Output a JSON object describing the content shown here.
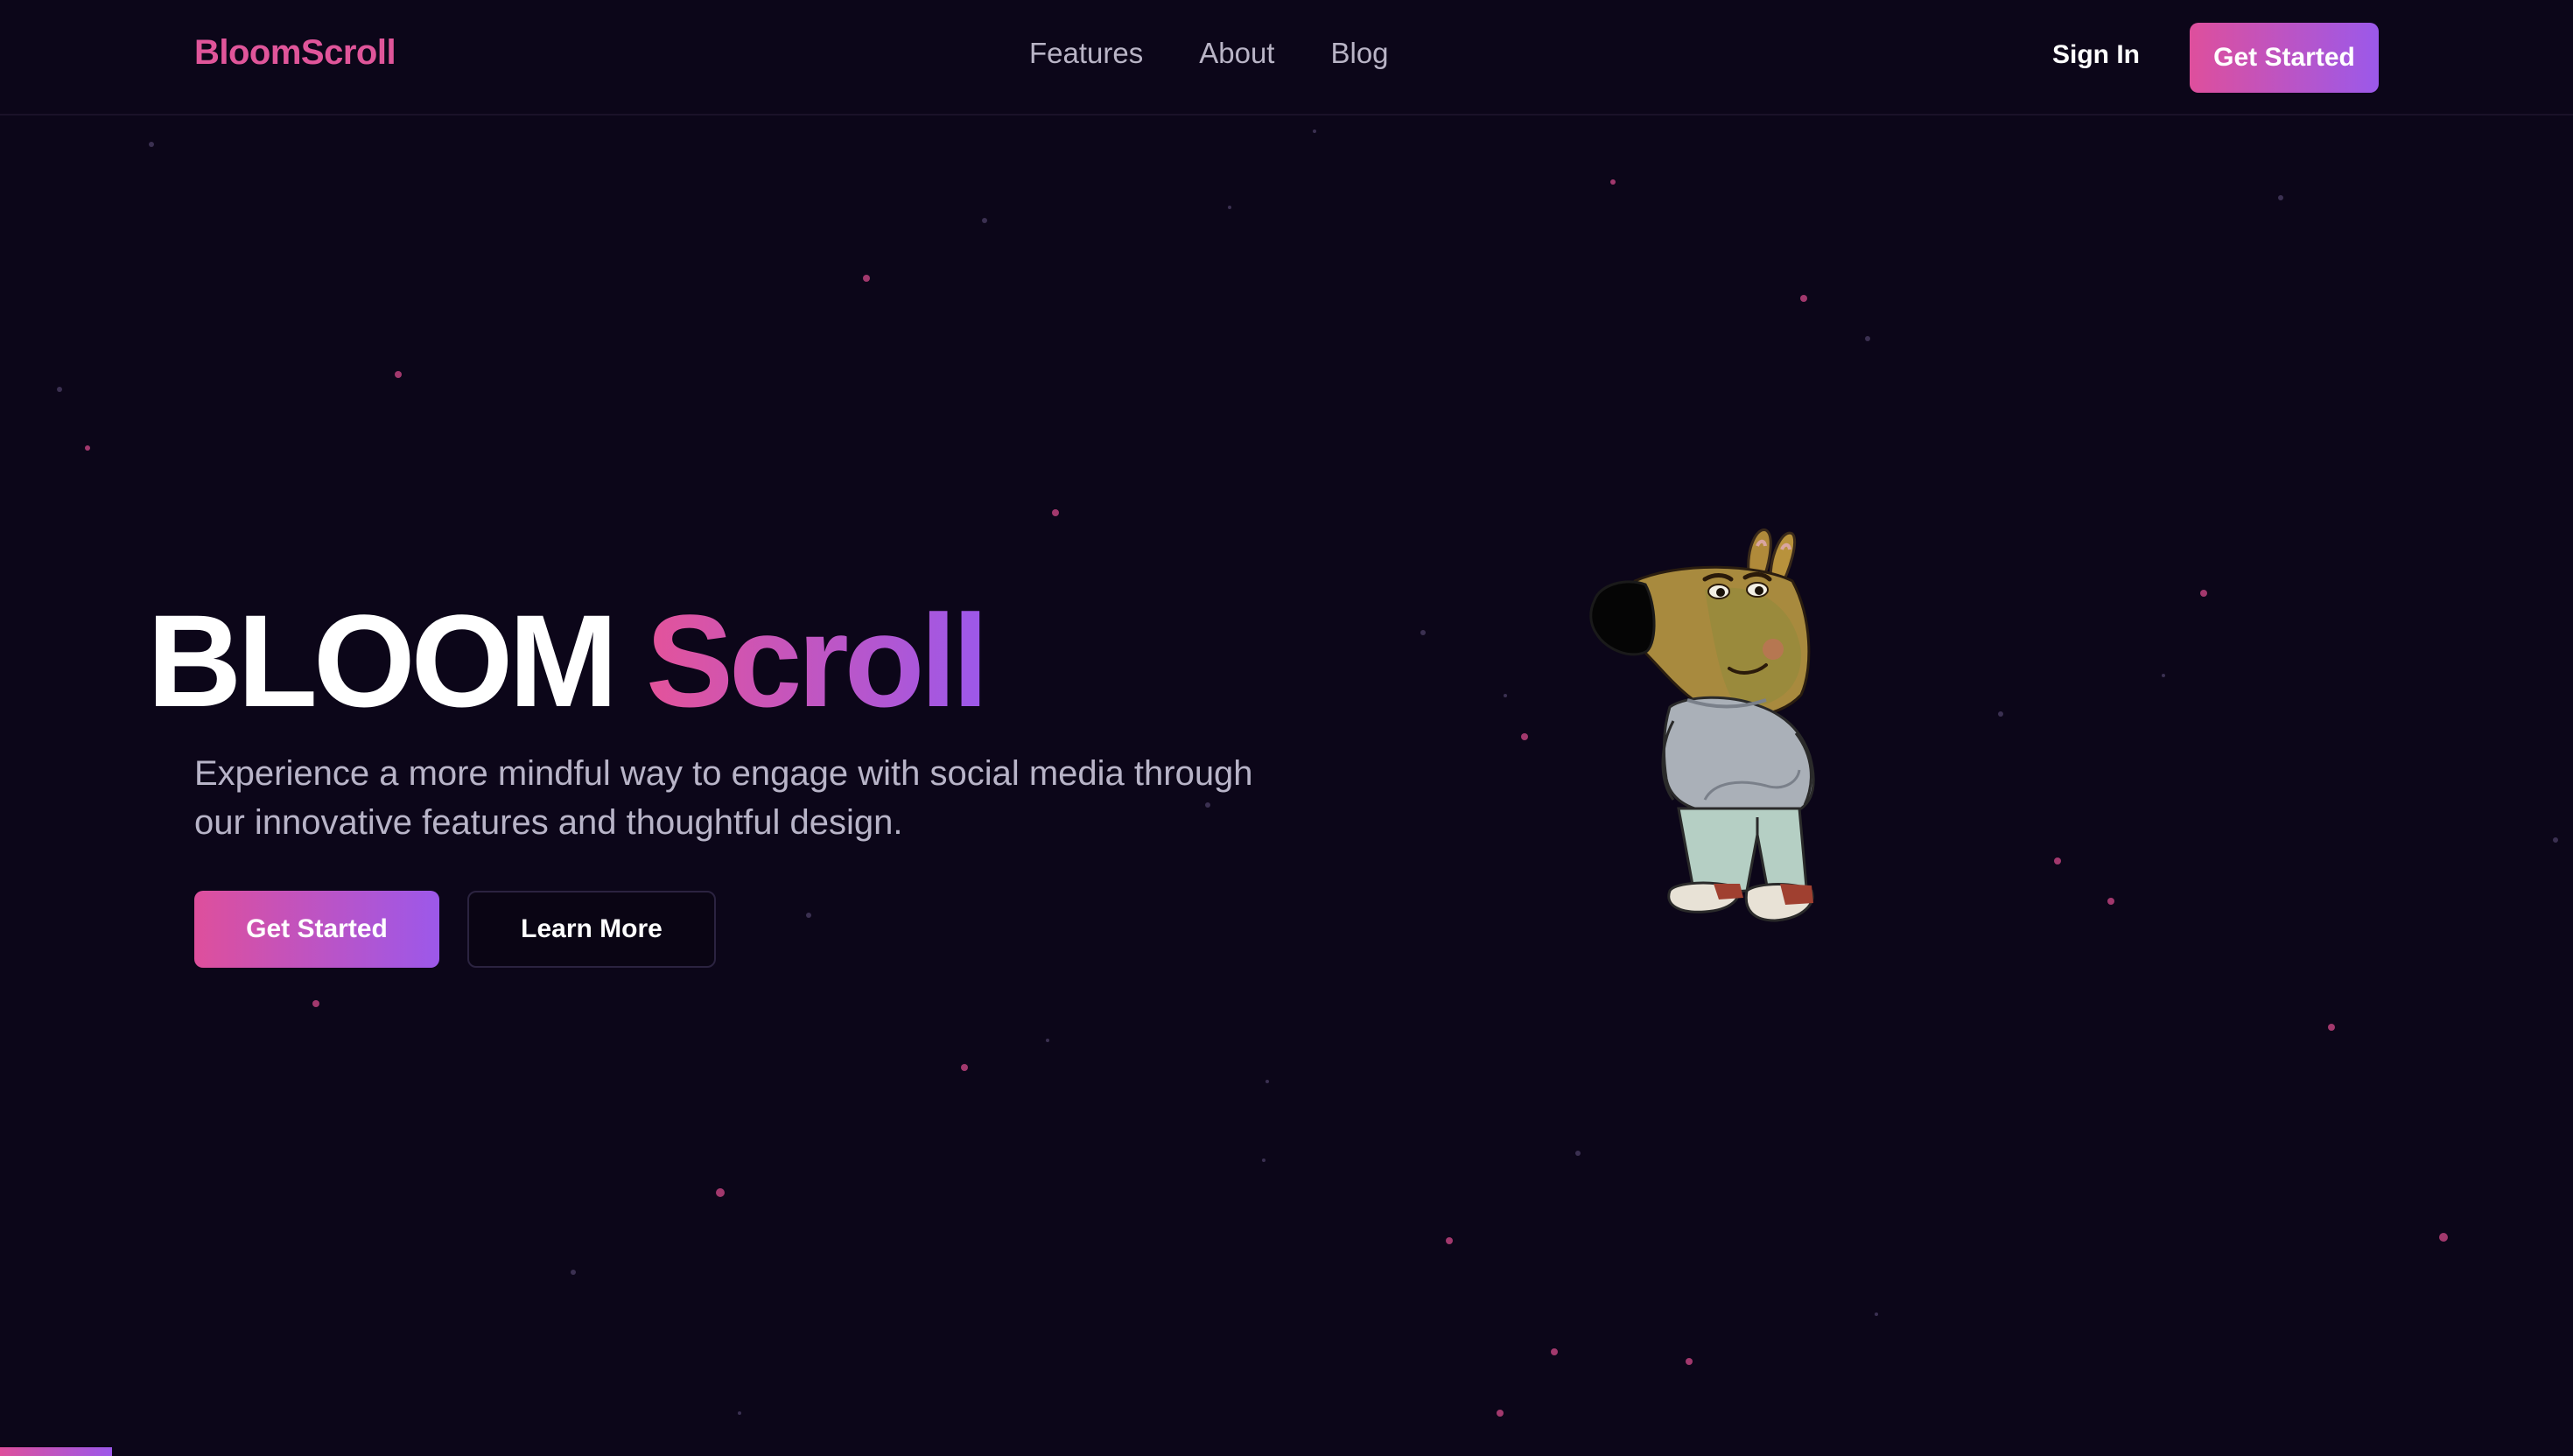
{
  "app": {
    "logo": "BloomScroll"
  },
  "nav": {
    "links": [
      "Features",
      "About",
      "Blog"
    ],
    "sign_in": "Sign In",
    "cta": "Get Started"
  },
  "hero": {
    "title_plain": "BLOOM",
    "title_gradient": "Scroll",
    "subtitle_line1": "Experience a more mindful way to engage with social media through",
    "subtitle_line2": "our innovative features and thoughtful design.",
    "primary_cta": "Get Started",
    "secondary_cta": "Learn More"
  },
  "colors": {
    "background": "#0c0619",
    "accent_pink": "#e0559a",
    "accent_purple": "#9c58ea",
    "muted_text": "#b8b4c8"
  },
  "icons": {
    "mascot": "cartoon-dog-mascot-icon"
  }
}
